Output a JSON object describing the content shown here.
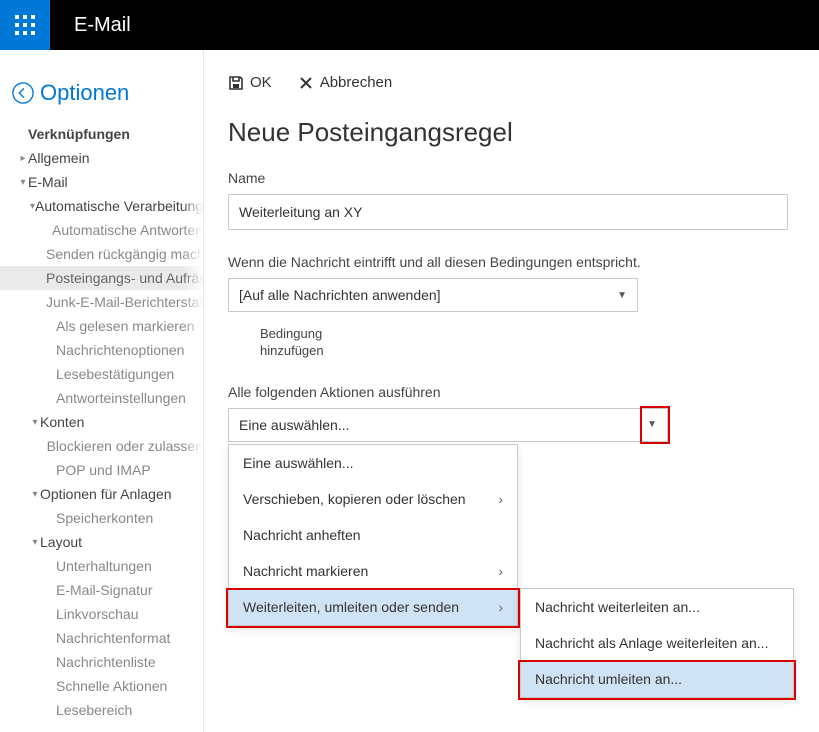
{
  "header": {
    "app": "E-Mail"
  },
  "sidebar": {
    "back": "Optionen",
    "items": [
      {
        "label": "Verknüpfungen",
        "level": "lvl1",
        "caret": ""
      },
      {
        "label": "Allgemein",
        "level": "lvl1b",
        "caret": "▸"
      },
      {
        "label": "E-Mail",
        "level": "lvl1b",
        "caret": "▾"
      },
      {
        "label": "Automatische Verarbeitung",
        "level": "lvl2",
        "caret": "▾"
      },
      {
        "label": "Automatische Antworten",
        "level": "lvl3",
        "caret": ""
      },
      {
        "label": "Senden rückgängig machen",
        "level": "lvl3",
        "caret": ""
      },
      {
        "label": "Posteingangs- und Aufräumen",
        "level": "lvl3",
        "caret": "",
        "selected": true
      },
      {
        "label": "Junk-E-Mail-Berichterstattung",
        "level": "lvl3",
        "caret": ""
      },
      {
        "label": "Als gelesen markieren",
        "level": "lvl3",
        "caret": ""
      },
      {
        "label": "Nachrichtenoptionen",
        "level": "lvl3",
        "caret": ""
      },
      {
        "label": "Lesebestätigungen",
        "level": "lvl3",
        "caret": ""
      },
      {
        "label": "Antworteinstellungen",
        "level": "lvl3",
        "caret": ""
      },
      {
        "label": "Konten",
        "level": "lvl2",
        "caret": "▾"
      },
      {
        "label": "Blockieren oder zulassen",
        "level": "lvl3",
        "caret": ""
      },
      {
        "label": "POP und IMAP",
        "level": "lvl3",
        "caret": ""
      },
      {
        "label": "Optionen für Anlagen",
        "level": "lvl2",
        "caret": "▾"
      },
      {
        "label": "Speicherkonten",
        "level": "lvl3",
        "caret": ""
      },
      {
        "label": "Layout",
        "level": "lvl2",
        "caret": "▾"
      },
      {
        "label": "Unterhaltungen",
        "level": "lvl3",
        "caret": ""
      },
      {
        "label": "E-Mail-Signatur",
        "level": "lvl3",
        "caret": ""
      },
      {
        "label": "Linkvorschau",
        "level": "lvl3",
        "caret": ""
      },
      {
        "label": "Nachrichtenformat",
        "level": "lvl3",
        "caret": ""
      },
      {
        "label": "Nachrichtenliste",
        "level": "lvl3",
        "caret": ""
      },
      {
        "label": "Schnelle Aktionen",
        "level": "lvl3",
        "caret": ""
      },
      {
        "label": "Lesebereich",
        "level": "lvl3",
        "caret": ""
      }
    ]
  },
  "cmd": {
    "ok": "OK",
    "cancel": "Abbrechen"
  },
  "page": {
    "title": "Neue Posteingangsregel",
    "name_label": "Name",
    "name_value": "Weiterleitung an XY",
    "cond_label": "Wenn die Nachricht eintrifft und all diesen Bedingungen entspricht.",
    "cond_value": "[Auf alle Nachrichten anwenden]",
    "add_cond": "Bedingung\nhinzufügen",
    "act_label": "Alle folgenden Aktionen ausführen",
    "act_value": "Eine auswählen..."
  },
  "menu": {
    "items": [
      {
        "label": "Eine auswählen...",
        "arrow": false
      },
      {
        "label": "Verschieben, kopieren oder löschen",
        "arrow": true
      },
      {
        "label": "Nachricht anheften",
        "arrow": false
      },
      {
        "label": "Nachricht markieren",
        "arrow": true
      },
      {
        "label": "Weiterleiten, umleiten oder senden",
        "arrow": true,
        "hl": true
      }
    ],
    "sub": [
      {
        "label": "Nachricht weiterleiten an..."
      },
      {
        "label": "Nachricht als Anlage weiterleiten an..."
      },
      {
        "label": "Nachricht umleiten an...",
        "sel": true
      }
    ]
  }
}
